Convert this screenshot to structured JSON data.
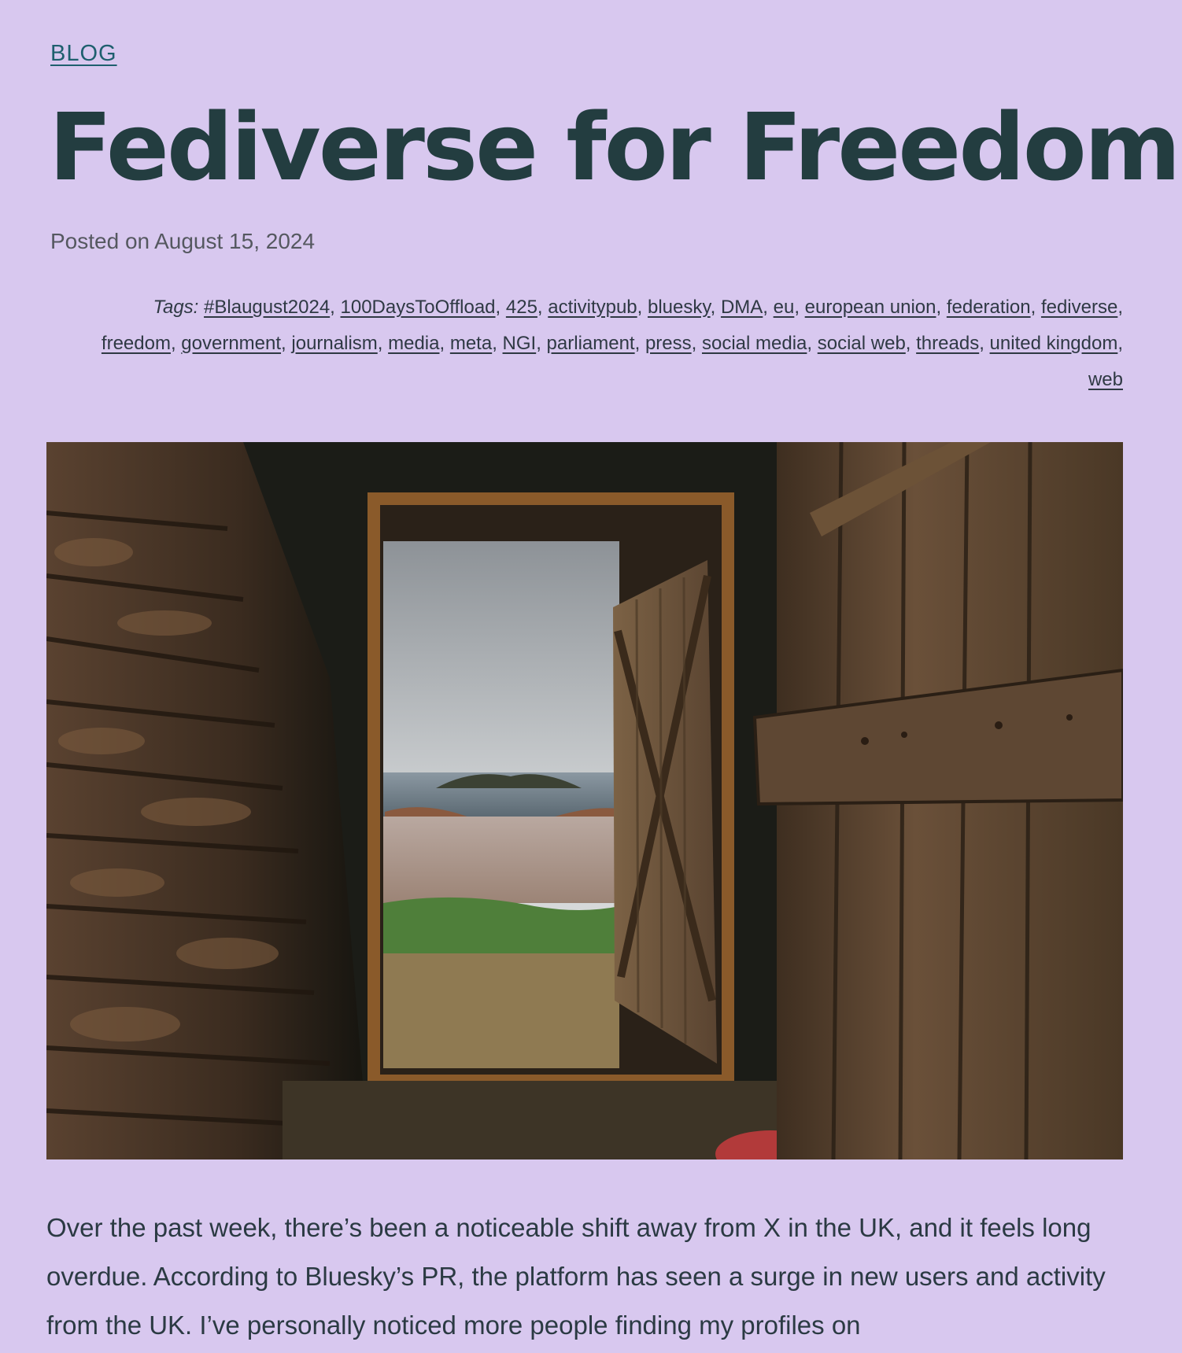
{
  "header": {
    "category_label": "BLOG",
    "title": "Fediverse for Freedom",
    "posted_prefix": "Posted on",
    "posted_date": "August 15, 2024"
  },
  "tags": {
    "label": "Tags:",
    "items": [
      "#Blaugust2024",
      "100DaysToOffload",
      "425",
      "activitypub",
      "bluesky",
      "DMA",
      "eu",
      "european union",
      "federation",
      "fediverse",
      "freedom",
      "government",
      "journalism",
      "media",
      "meta",
      "NGI",
      "parliament",
      "press",
      "social media",
      "social web",
      "threads",
      "united kingdom",
      "web"
    ]
  },
  "hero_image": {
    "icon": "photo-open-barn-door-to-sea"
  },
  "article": {
    "intro": "Over the past week, there’s been a noticeable shift away from X in the UK, and it feels long overdue. According to Bluesky’s PR, the platform has seen a surge in new users and activity from the UK. I’ve personally noticed more people finding my profiles on"
  },
  "colors": {
    "background": "#d8c8ef",
    "title": "#233d40",
    "link": "#1e5f6e",
    "text": "#2b3a43"
  }
}
